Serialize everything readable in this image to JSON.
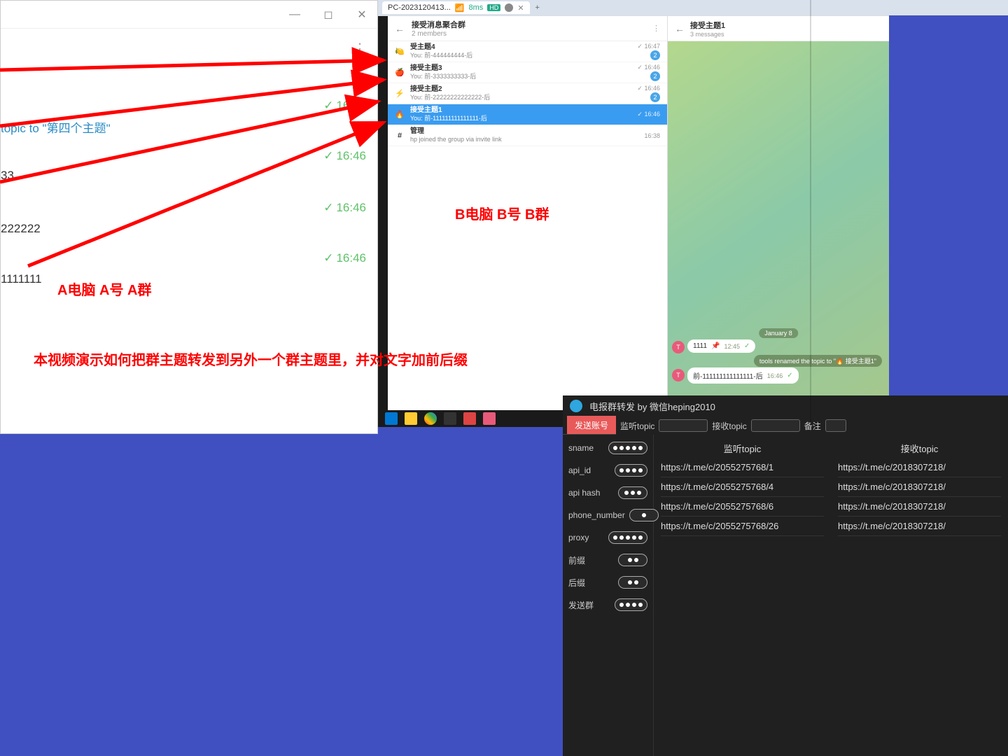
{
  "winA": {
    "topic_link": "topic to \"第四个主题\"",
    "rows": [
      {
        "txt": "",
        "ts": "16:47"
      },
      {
        "txt": "33",
        "ts": "16:46"
      },
      {
        "txt": "222222",
        "ts": "16:46"
      },
      {
        "txt": "1111111",
        "ts": "16:46"
      }
    ]
  },
  "annotations": {
    "labelA": "A电脑 A号 A群",
    "labelB": "B电脑 B号 B群",
    "caption": "本视频演示如何把群主题转发到另外一个群主题里，并对文字加前后缀"
  },
  "browser": {
    "tab_title": "PC-202312041З...",
    "tab_meta": "8ms",
    "tab_badge": "HD"
  },
  "winB": {
    "list_title": "接受消息聚合群",
    "list_sub": "2 members",
    "chat_title": "接受主题1",
    "chat_sub": "3 messages",
    "topics": [
      {
        "ico": "🍋",
        "name": "受主题4",
        "msg": "You: 前-444444444-后",
        "time": "✓ 16:47",
        "badge": "2"
      },
      {
        "ico": "🍎",
        "name": "接受主题3",
        "msg": "You: 前-3333333333-后",
        "time": "✓ 16:46",
        "badge": "2"
      },
      {
        "ico": "⚡",
        "name": "接受主题2",
        "msg": "You: 前-22222222222222-后",
        "time": "✓ 16:46",
        "badge": "2"
      },
      {
        "ico": "🔥",
        "name": "接受主题1",
        "msg": "You: 前-111111111111111-后",
        "time": "✓ 16:46",
        "badge": "",
        "sel": true
      },
      {
        "ico": "#",
        "name": "管理",
        "msg": "hp joined the group via invite link",
        "time": "16:38",
        "badge": ""
      }
    ],
    "date_chip": "January 8",
    "msg1": "1111",
    "msg1_time": "12:45",
    "sys": "tools renamed the topic to \"🔥 接受主题1\"",
    "msg2": "前-111111111111111-后",
    "msg2_time": "16:46"
  },
  "tool": {
    "title": "电报群转发 by 微信heping2010",
    "tab_send": "发送账号",
    "lbl_listen": "监听topic",
    "lbl_recv": "接收topic",
    "lbl_note": "备注",
    "col_listen": "监听topic",
    "col_recv": "接收topic",
    "fields": [
      {
        "label": "sname",
        "dots": 5
      },
      {
        "label": "api_id",
        "dots": 4
      },
      {
        "label": "api hash",
        "dots": 3
      },
      {
        "label": "phone_number",
        "dots": 1
      },
      {
        "label": "proxy",
        "dots": 5
      },
      {
        "label": "前缀",
        "dots": 2
      },
      {
        "label": "后缀",
        "dots": 2
      },
      {
        "label": "发送群",
        "dots": 4
      }
    ],
    "listen_urls": [
      "https://t.me/c/2055275768/1",
      "https://t.me/c/2055275768/4",
      "https://t.me/c/2055275768/6",
      "https://t.me/c/2055275768/26"
    ],
    "recv_urls": [
      "https://t.me/c/2018307218/",
      "https://t.me/c/2018307218/",
      "https://t.me/c/2018307218/",
      "https://t.me/c/2018307218/"
    ]
  }
}
